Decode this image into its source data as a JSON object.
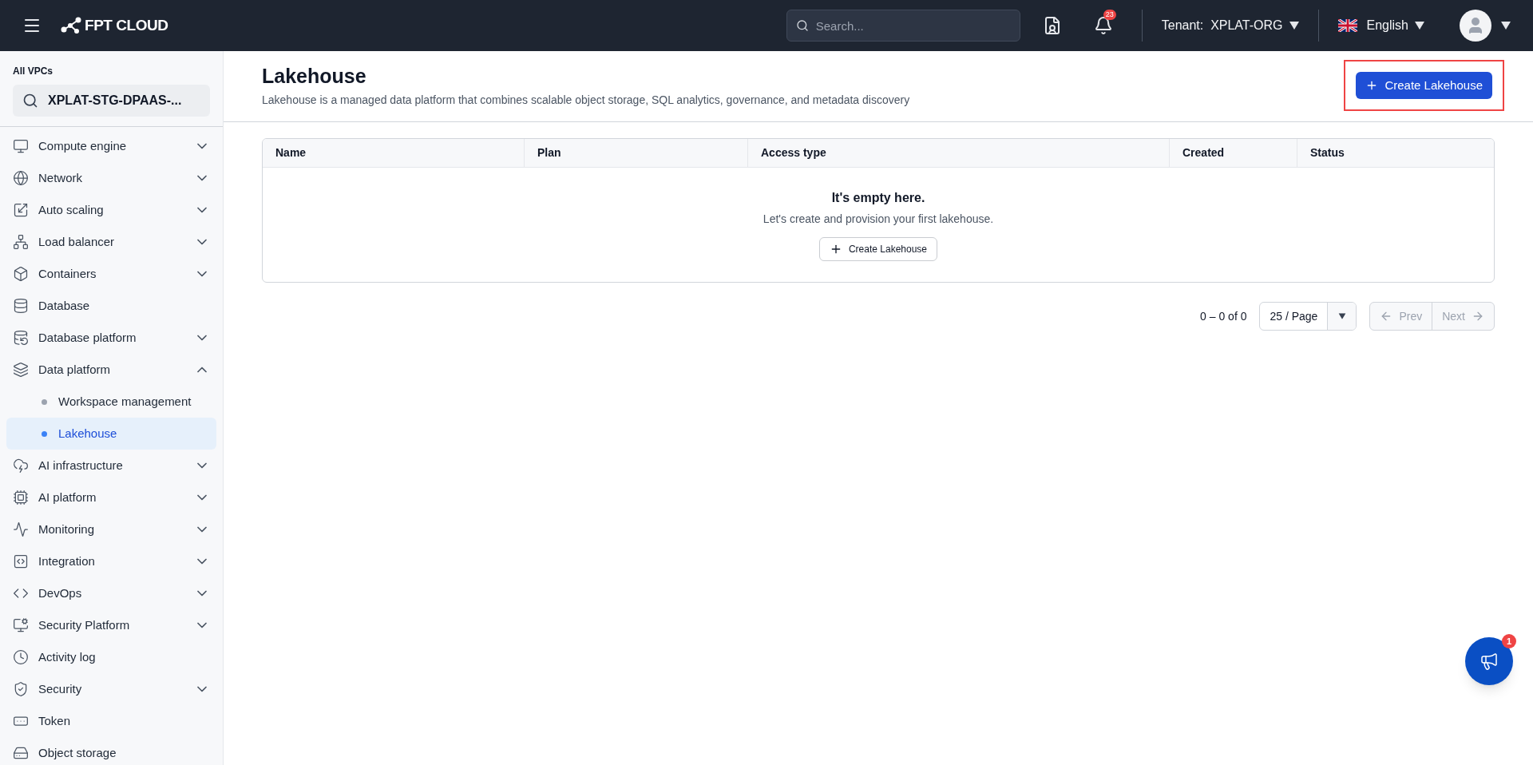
{
  "header": {
    "brand": "FPT CLOUD",
    "search": {
      "placeholder": "Search..."
    },
    "notification_count": "23",
    "tenant_label": "Tenant:",
    "tenant": "XPLAT-ORG",
    "language": "English"
  },
  "sidebar": {
    "vpc_label": "All VPCs",
    "vpc": "XPLAT-STG-DPAAS-...",
    "items": [
      {
        "kind": "group",
        "label": "Compute engine",
        "expanded": false
      },
      {
        "kind": "group",
        "label": "Network",
        "expanded": false
      },
      {
        "kind": "group",
        "label": "Auto scaling",
        "expanded": false
      },
      {
        "kind": "group",
        "label": "Load balancer",
        "expanded": false
      },
      {
        "kind": "group",
        "label": "Containers",
        "expanded": false
      },
      {
        "kind": "link",
        "label": "Database"
      },
      {
        "kind": "group",
        "label": "Database platform",
        "expanded": false
      },
      {
        "kind": "group",
        "label": "Data platform",
        "expanded": true,
        "children": [
          {
            "label": "Workspace management",
            "selected": false
          },
          {
            "label": "Lakehouse",
            "selected": true
          }
        ]
      },
      {
        "kind": "group",
        "label": "AI infrastructure",
        "expanded": false
      },
      {
        "kind": "group",
        "label": "AI platform",
        "expanded": false
      },
      {
        "kind": "group",
        "label": "Monitoring",
        "expanded": false
      },
      {
        "kind": "group",
        "label": "Integration",
        "expanded": false
      },
      {
        "kind": "group",
        "label": "DevOps",
        "expanded": false
      },
      {
        "kind": "group",
        "label": "Security Platform",
        "expanded": false
      },
      {
        "kind": "link",
        "label": "Activity log"
      },
      {
        "kind": "group",
        "label": "Security",
        "expanded": false
      },
      {
        "kind": "link",
        "label": "Token"
      },
      {
        "kind": "link",
        "label": "Object storage"
      }
    ]
  },
  "page": {
    "title": "Lakehouse",
    "description": "Lakehouse is a managed data platform that combines scalable object storage, SQL analytics, governance, and metadata discovery",
    "create_button": "Create Lakehouse"
  },
  "table": {
    "columns": [
      "Name",
      "Plan",
      "Access type",
      "Created",
      "Status"
    ],
    "empty_title": "It's empty here.",
    "empty_text": "Let's create and provision your first lakehouse.",
    "empty_button": "Create Lakehouse"
  },
  "pagination": {
    "range": "0 – 0 of 0",
    "page_size": "25 / Page",
    "prev": "Prev",
    "next": "Next",
    "prev_disabled": true,
    "next_disabled": true
  },
  "fab": {
    "badge": "1"
  }
}
